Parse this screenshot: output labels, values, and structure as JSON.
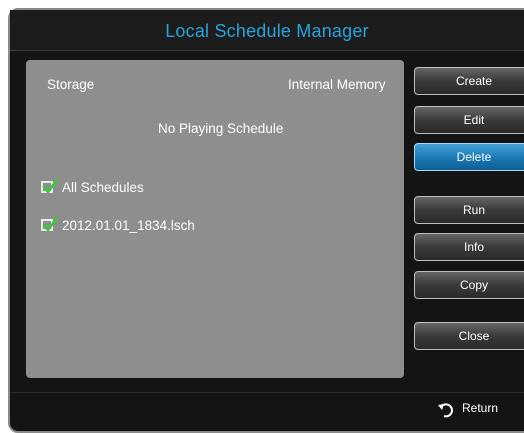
{
  "window": {
    "title": "Local Schedule Manager"
  },
  "panel": {
    "storage_label": "Storage",
    "storage_value": "Internal Memory",
    "status": "No Playing Schedule",
    "items": [
      {
        "label": "All Schedules",
        "checked": true
      },
      {
        "label": "2012.01.01_1834.lsch",
        "checked": true
      }
    ]
  },
  "buttons": {
    "create": "Create",
    "edit": "Edit",
    "delete": "Delete",
    "run": "Run",
    "info": "Info",
    "copy": "Copy",
    "close": "Close"
  },
  "footer": {
    "return_label": "Return"
  },
  "colors": {
    "accent": "#2aa3df",
    "active_button": "#1a77b2",
    "check": "#33cc33"
  }
}
